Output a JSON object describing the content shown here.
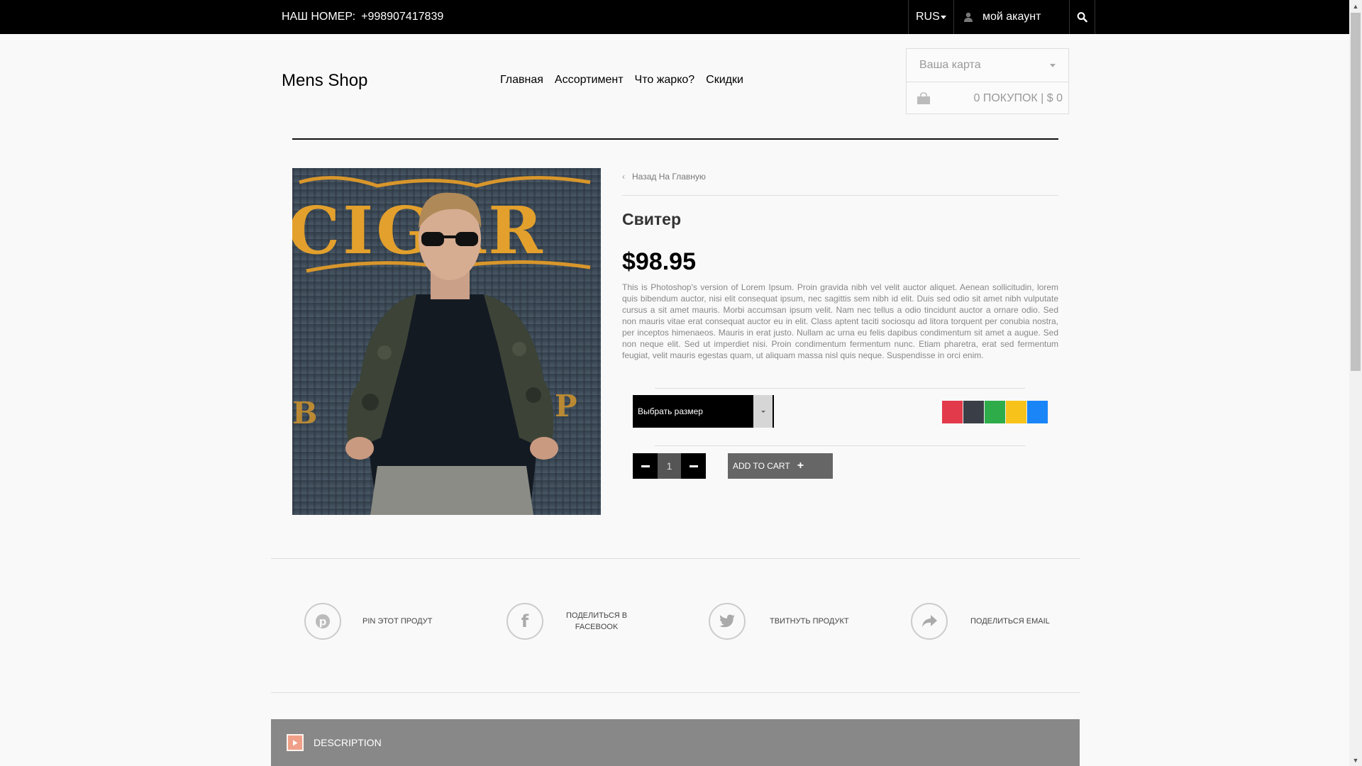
{
  "topbar": {
    "phone_label": "НАШ НОМЕР:",
    "phone_number": "+998907417839",
    "language": "RUS",
    "account": "мой акаунт"
  },
  "header": {
    "logo": "Mens Shop",
    "nav": [
      "Главная",
      "Ассортимент",
      "Что жарко?",
      "Скидки"
    ],
    "cart": {
      "select_placeholder": "Ваша карта",
      "summary": "0 ПОКУПОК | $ 0"
    }
  },
  "product": {
    "back_link": "Назад На Главную",
    "title": "Свитер",
    "price": "$98.95",
    "description": "This is Photoshop's version of Lorem Ipsum. Proin gravida nibh vel velit auctor aliquet. Aenean sollicitudin, lorem quis bibendum auctor, nisi elit consequat ipsum, nec sagittis sem nibh id elit. Duis sed odio sit amet nibh vulputate cursus a sit amet mauris. Morbi accumsan ipsum velit. Nam nec tellus a odio tincidunt auctor a ornare odio. Sed non mauris vitae erat consequat auctor eu in elit. Class aptent taciti sociosqu ad litora torquent per conubia nostra, per inceptos himenaeos. Mauris in erat justo. Nullam ac urna eu felis dapibus condimentum sit amet a augue. Sed non neque elit. Sed ut imperdiet nisi. Proin condimentum fermentum nunc. Etiam pharetra, erat sed fermentum feugiat, velit mauris egestas quam, ut aliquam massa nisl quis neque. Suspendisse in orci enim.",
    "size_select": "Выбрать размер",
    "colors": [
      "#e23a4a",
      "#3a3f47",
      "#2eac4a",
      "#f7c31a",
      "#1a85f7"
    ],
    "quantity": "1",
    "add_to_cart": "ADD TO CART"
  },
  "share": {
    "pin": "PIN ЭТОТ ПРОДУТ",
    "facebook_line1": "ПОДЕЛИТЬСЯ В",
    "facebook_line2": "FACEBOOK",
    "tweet": "ТВИТНУТЬ ПРОДУКТ",
    "email": "ПОДЕЛИТЬСЯ EMAIL"
  },
  "tabs": {
    "description": "DESCRIPTION"
  }
}
